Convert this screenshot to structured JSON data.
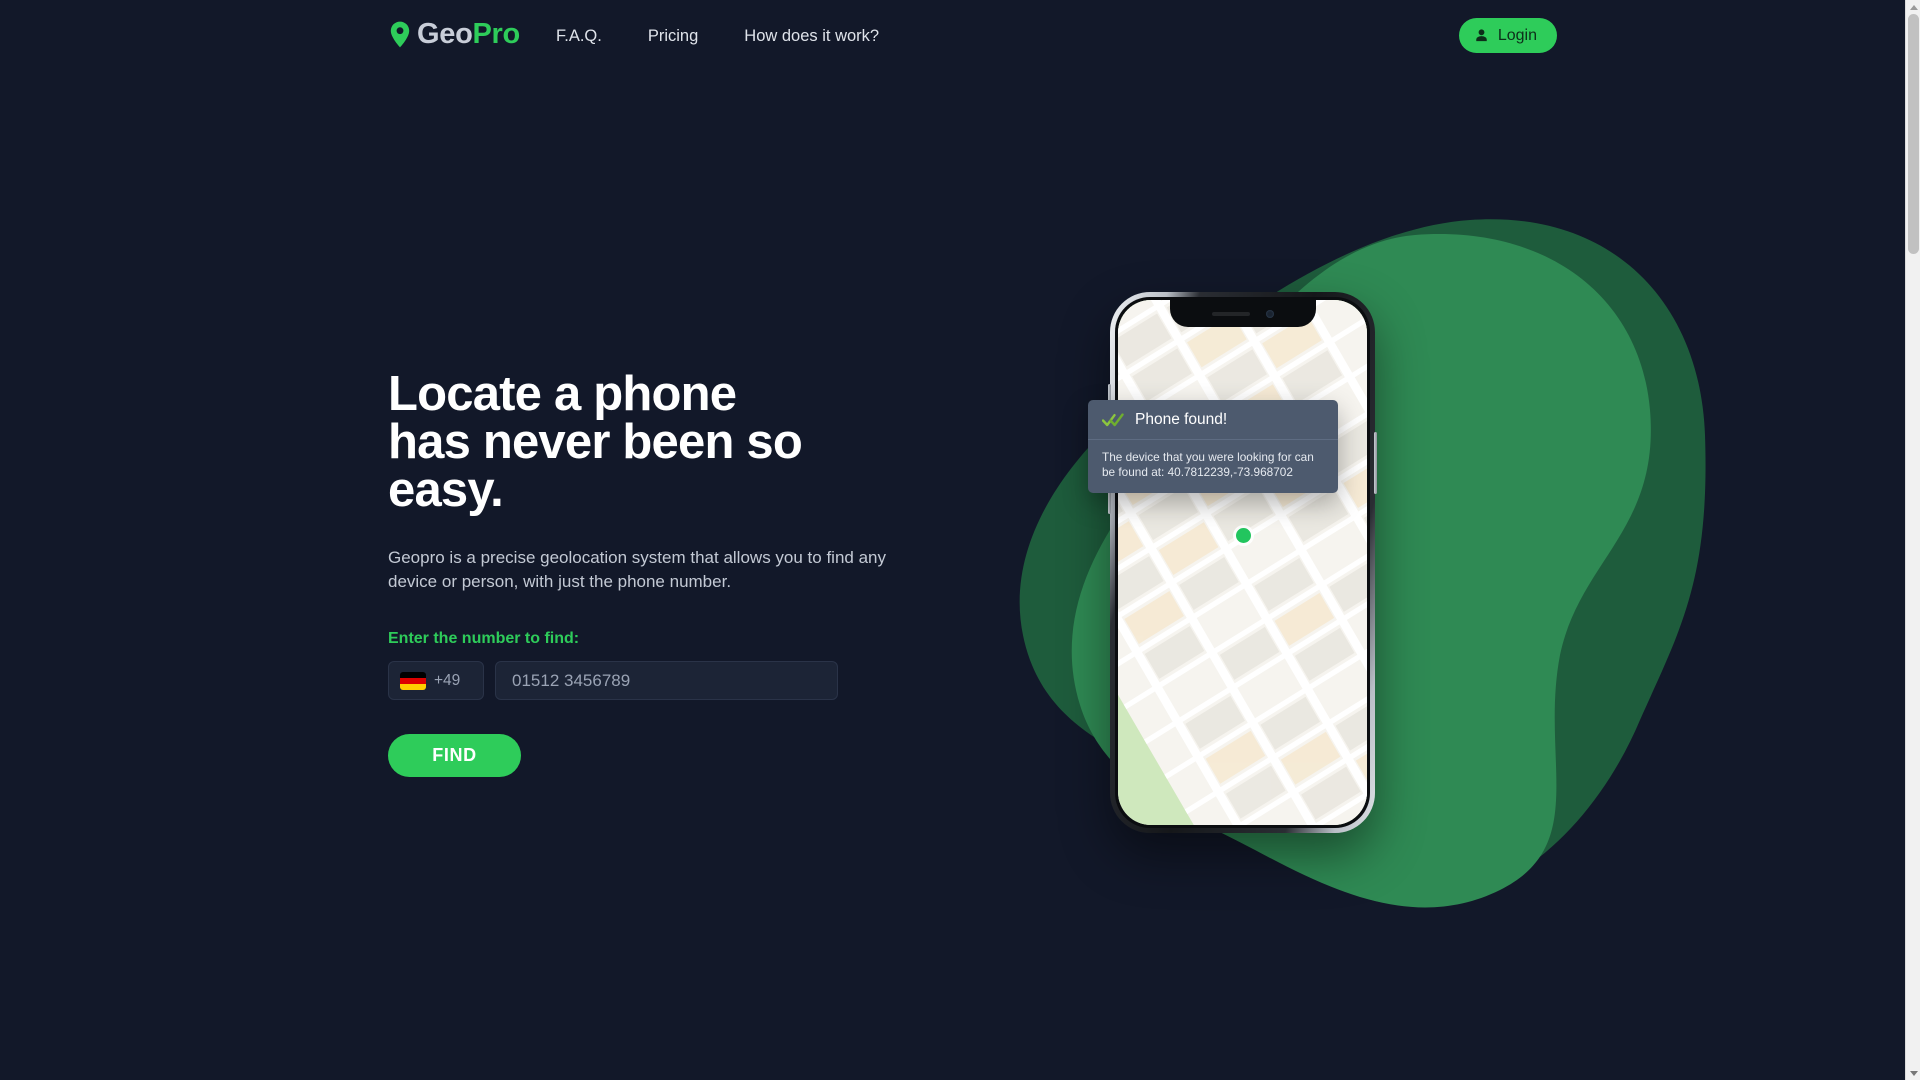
{
  "theme": {
    "background": "#121829",
    "accent_green": "#2ecc5a",
    "blob_front": "#2f8a54",
    "blob_back": "#1e5c3c",
    "notification_bg": "#4d5a6e",
    "text_primary": "#ffffff",
    "text_muted": "#c3c9d4"
  },
  "header": {
    "logo": {
      "icon": "map-pin-icon",
      "text_primary": "Geo",
      "text_accent": "Pro"
    },
    "nav_items": [
      {
        "label": "F.A.Q."
      },
      {
        "label": "Pricing"
      },
      {
        "label": "How does it work?"
      }
    ],
    "login": {
      "icon": "person-icon",
      "label": "Login"
    }
  },
  "hero": {
    "headline": "Locate a phone\nhas never been so\neasy.",
    "subtext": "Geopro is a precise geolocation system that allows you to find any\ndevice or person, with just the phone number.",
    "form": {
      "label": "Enter the number to find:",
      "country": {
        "flag": "germany-flag-icon",
        "dial_code": "+49"
      },
      "phone_placeholder": "01512 3456789",
      "phone_value": "",
      "submit_label": "FIND"
    }
  },
  "illustration": {
    "phone_mockup": {
      "notch_icons": [
        "speaker-grill",
        "front-camera"
      ],
      "map": {
        "location_marker": "green-location-dot"
      }
    },
    "notification": {
      "icon": "double-check-icon",
      "title": "Phone found!",
      "body": "The device that you were looking for can be found at: 40.7812239,-73.968702"
    }
  },
  "scrollbar": {
    "up_arrow": "chevron-up-icon",
    "down_arrow": "chevron-down-icon"
  }
}
